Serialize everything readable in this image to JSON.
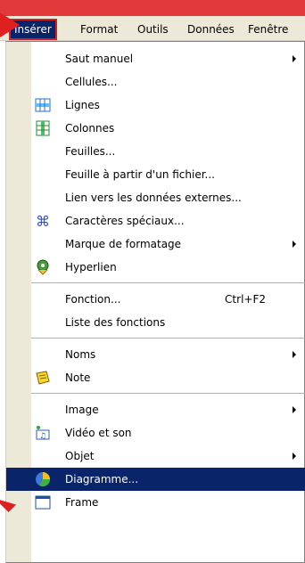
{
  "menubar": {
    "items": [
      {
        "label": "Insérer",
        "active": true
      },
      {
        "label": "Format"
      },
      {
        "label": "Outils"
      },
      {
        "label": "Données"
      },
      {
        "label": "Fenêtre"
      }
    ]
  },
  "menu": {
    "items": [
      {
        "label": "Saut manuel",
        "submenu": true
      },
      {
        "label": "Cellules..."
      },
      {
        "label": "Lignes",
        "icon": "insert-rows-icon"
      },
      {
        "label": "Colonnes",
        "icon": "insert-columns-icon"
      },
      {
        "label": "Feuilles..."
      },
      {
        "label": "Feuille à partir d'un fichier..."
      },
      {
        "label": "Lien vers les données externes..."
      },
      {
        "label": "Caractères spéciaux...",
        "icon": "special-characters-icon"
      },
      {
        "label": "Marque de formatage",
        "submenu": true
      },
      {
        "label": "Hyperlien",
        "icon": "hyperlink-icon"
      },
      {
        "label": "Fonction...",
        "shortcut": "Ctrl+F2"
      },
      {
        "label": "Liste des fonctions"
      },
      {
        "label": "Noms",
        "submenu": true
      },
      {
        "label": "Note",
        "icon": "note-icon"
      },
      {
        "label": "Image",
        "submenu": true
      },
      {
        "label": "Vidéo et son",
        "icon": "video-sound-icon"
      },
      {
        "label": "Objet",
        "submenu": true
      },
      {
        "label": "Diagramme...",
        "icon": "chart-pie-icon",
        "selected": true
      },
      {
        "label": "Frame",
        "icon": "frame-icon"
      }
    ]
  },
  "colors": {
    "highlight": "#0a246a",
    "annotation_arrow": "#e02020"
  }
}
